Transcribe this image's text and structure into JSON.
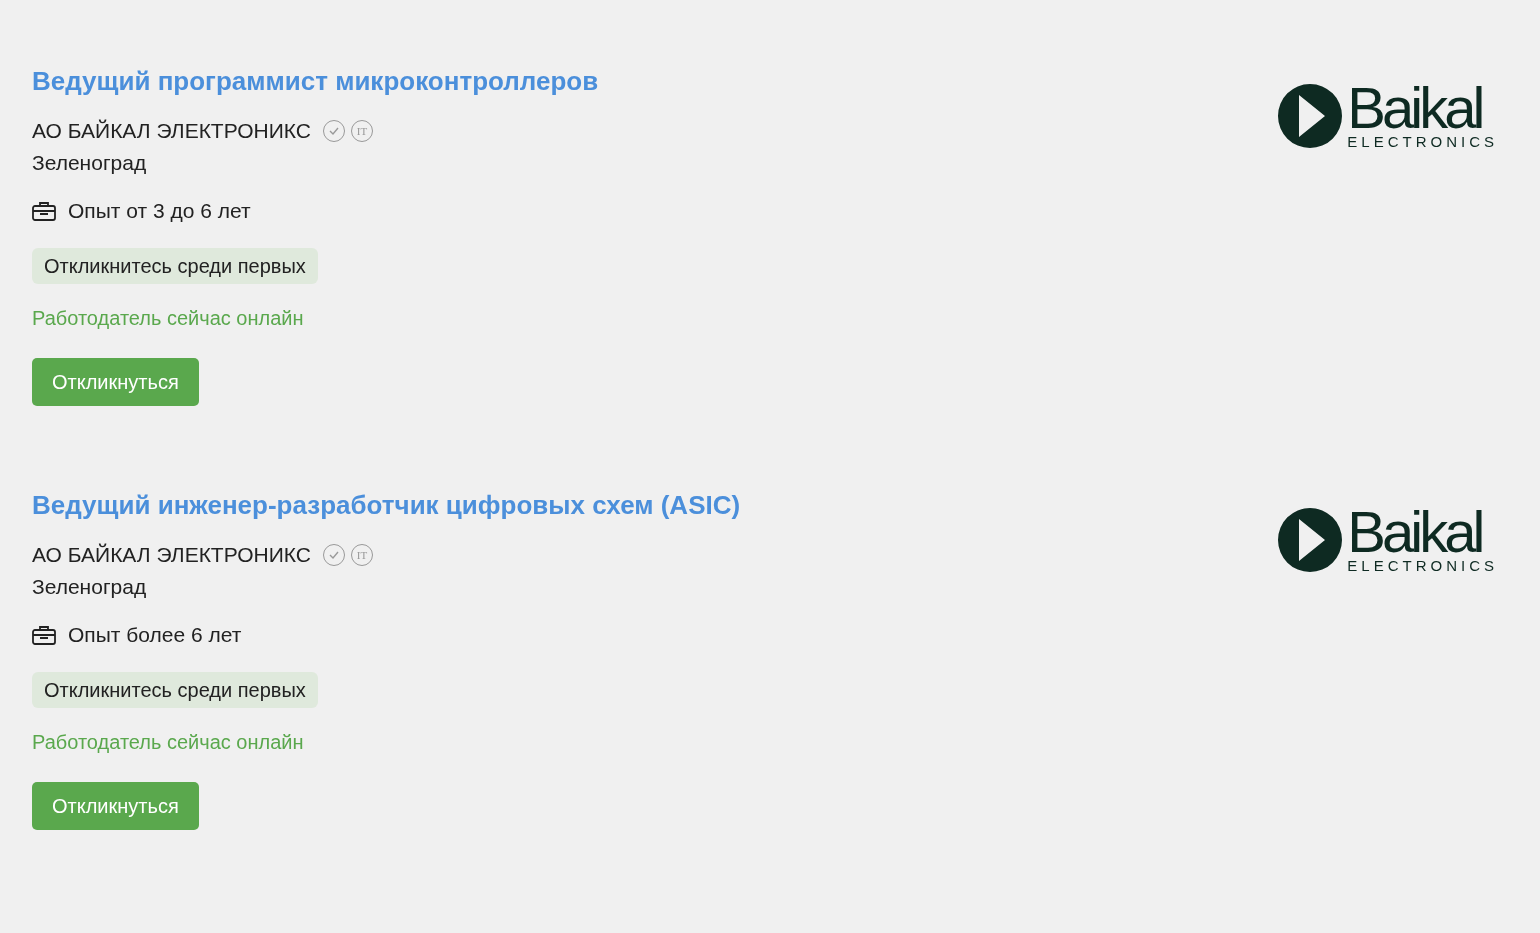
{
  "vacancies": [
    {
      "title": "Ведущий программист микроконтроллеров",
      "company": "АО БАЙКАЛ ЭЛЕКТРОНИКС",
      "it_badge": "IT",
      "city": "Зеленоград",
      "experience": "Опыт от 3 до 6 лет",
      "tag": "Откликнитесь среди первых",
      "online": "Работодатель сейчас онлайн",
      "button": "Откликнуться",
      "logo": {
        "name": "Baikal",
        "sub": "ELECTRONICS"
      }
    },
    {
      "title": "Ведущий инженер-разработчик цифровых схем (ASIC)",
      "company": "АО БАЙКАЛ ЭЛЕКТРОНИКС",
      "it_badge": "IT",
      "city": "Зеленоград",
      "experience": "Опыт более 6 лет",
      "tag": "Откликнитесь среди первых",
      "online": "Работодатель сейчас онлайн",
      "button": "Откликнуться",
      "logo": {
        "name": "Baikal",
        "sub": "ELECTRONICS"
      }
    }
  ]
}
